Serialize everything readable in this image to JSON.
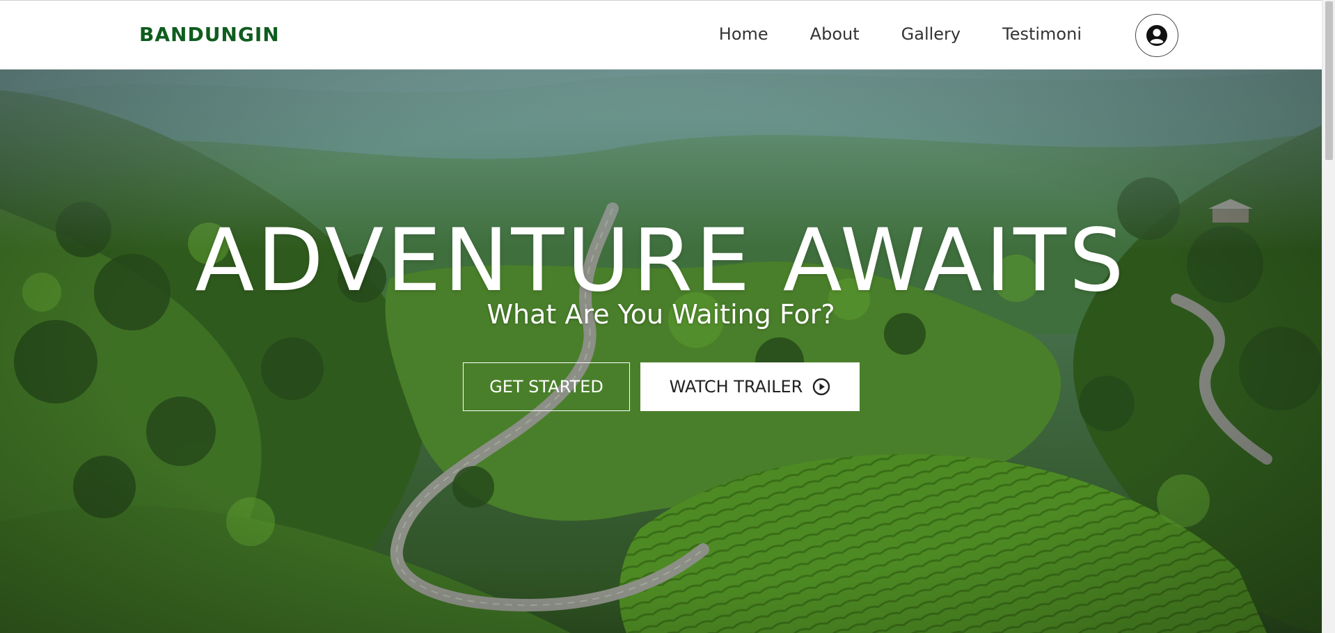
{
  "brand": {
    "name": "BANDUNGIN",
    "color": "#0f5c1f"
  },
  "nav": {
    "items": [
      {
        "label": "Home"
      },
      {
        "label": "About"
      },
      {
        "label": "Gallery"
      },
      {
        "label": "Testimoni"
      }
    ],
    "profile_icon": "user-circle-icon"
  },
  "hero": {
    "title": "ADVENTURE AWAITS",
    "subtitle": "What Are You Waiting For?",
    "primary_button": "GET STARTED",
    "secondary_button": "WATCH TRAILER",
    "secondary_icon": "play-circle-icon",
    "background": "aerial-green-valley-winding-road"
  }
}
